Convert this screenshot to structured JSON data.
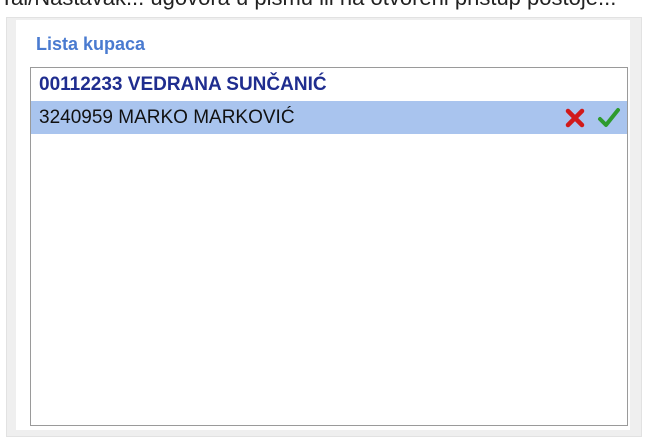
{
  "top_strip_text": "Tal/Nastavak... ugovora u pismu ili na otvoreni pristup postoje...",
  "panel": {
    "title": "Lista kupaca"
  },
  "list": {
    "items": [
      {
        "label": "00112233 VEDRANA SUNČANIĆ",
        "style": "header"
      },
      {
        "label": "3240959 MARKO MARKOVIĆ",
        "style": "selected",
        "actions": [
          "delete-icon",
          "confirm-icon"
        ]
      }
    ]
  },
  "colors": {
    "title": "#4a7bd0",
    "header_text": "#1f2d8f",
    "selected_row": "#a9c4ee",
    "delete": "#d11a1a",
    "confirm": "#2e9b2e"
  }
}
